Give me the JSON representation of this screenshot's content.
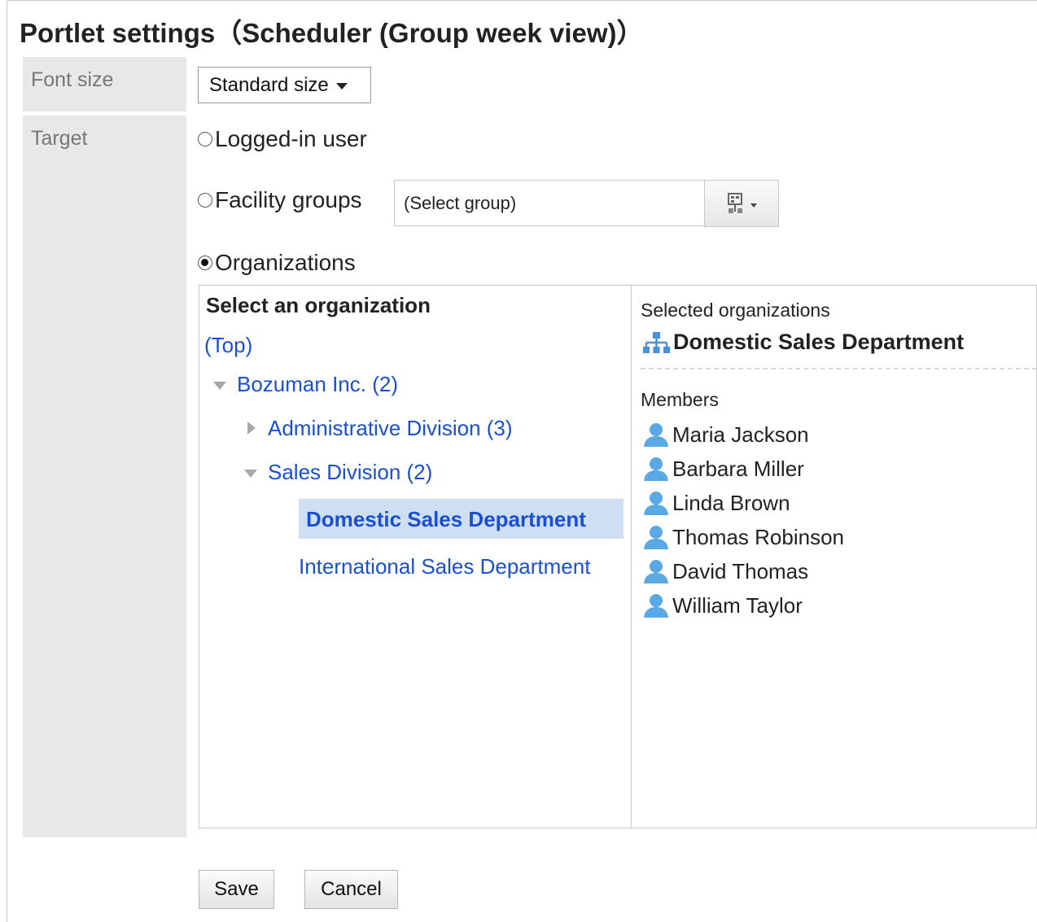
{
  "title": "Portlet settings（Scheduler (Group week view)）",
  "font_size": {
    "label": "Font size",
    "selected": "Standard size"
  },
  "target": {
    "label": "Target",
    "options": [
      {
        "label": "Logged-in user",
        "selected": false
      },
      {
        "label": "Facility groups",
        "selected": false
      },
      {
        "label": "Organizations",
        "selected": true
      }
    ],
    "facility_group_value": "(Select group)"
  },
  "org_panel": {
    "title": "Select an organization",
    "top_link": "(Top)",
    "tree": [
      {
        "label": "Bozuman Inc. (2)",
        "expanded": true
      },
      {
        "label": "Administrative Division (3)",
        "expanded": false
      },
      {
        "label": "Sales Division (2)",
        "expanded": true
      },
      {
        "label": "Domestic Sales Department",
        "selected": true
      },
      {
        "label": "International Sales Department",
        "selected": false
      }
    ]
  },
  "selected_panel": {
    "label": "Selected organizations",
    "organization": "Domestic Sales Department",
    "members_label": "Members",
    "members": [
      "Maria Jackson",
      "Barbara Miller",
      "Linda Brown",
      "Thomas Robinson",
      "David Thomas",
      "William Taylor"
    ]
  },
  "buttons": {
    "save": "Save",
    "cancel": "Cancel"
  },
  "icons": {
    "org": "org-chart-icon",
    "user": "user-icon",
    "group_select": "group-select-icon"
  },
  "colors": {
    "link": "#1a4fd0",
    "selected_bg": "#cfdff2",
    "label_bg": "#e8e8e8",
    "user_icon": "#5aa8e4"
  }
}
